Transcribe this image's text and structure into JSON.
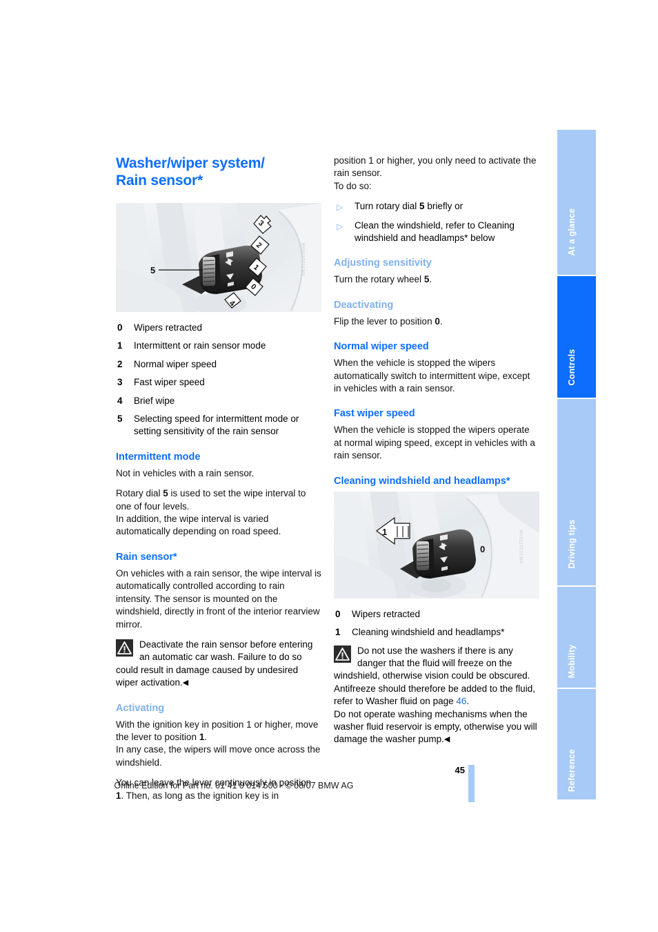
{
  "document": {
    "title": "Washer/wiper system/ Rain sensor*",
    "title_line1": "Washer/wiper system/",
    "title_line2": "Rain sensor*",
    "page_number": "45",
    "footer": "Online Edition for Part no. 01 41 0 014 500 - © 08/07 BMW AG"
  },
  "side_tabs": [
    {
      "label": "At a glance",
      "active": false
    },
    {
      "label": "Controls",
      "active": true
    },
    {
      "label": "Driving tips",
      "active": false
    },
    {
      "label": "Mobility",
      "active": false
    },
    {
      "label": "Reference",
      "active": false
    }
  ],
  "figures": {
    "lever_positions": {
      "caption_watermark": "MVD11TC1CMA",
      "callouts": [
        "0",
        "1",
        "2",
        "3",
        "4",
        "5"
      ]
    },
    "cleaning": {
      "caption_watermark": "MVD11TC1CMA",
      "callouts": [
        "0",
        "1"
      ]
    }
  },
  "left_column": {
    "legend": [
      {
        "num": "0",
        "text": "Wipers retracted"
      },
      {
        "num": "1",
        "text": "Intermittent or rain sensor mode"
      },
      {
        "num": "2",
        "text": "Normal wiper speed"
      },
      {
        "num": "3",
        "text": "Fast wiper speed"
      },
      {
        "num": "4",
        "text": "Brief wipe"
      },
      {
        "num": "5",
        "text": "Selecting speed for intermittent mode or setting sensitivity of the rain sensor"
      }
    ],
    "intermittent": {
      "heading": "Intermittent mode",
      "p1": "Not in vehicles with a rain sensor.",
      "p2_a": "Rotary dial ",
      "p2_b": "5",
      "p2_c": " is used to set the wipe interval to one of four levels.",
      "p3": "In addition, the wipe interval is varied automatically depending on road speed."
    },
    "rain_sensor": {
      "heading": "Rain sensor*",
      "p1": "On vehicles with a rain sensor, the wipe interval is automatically controlled according to rain intensity. The sensor is mounted on the windshield, directly in front of the interior rearview mirror.",
      "warning": "Deactivate the rain sensor before entering an automatic car wash. Failure to do so could result in damage caused by undesired wiper activation."
    },
    "activating": {
      "heading": "Activating",
      "p1_a": "With the ignition key in position 1 or higher, move the lever to position ",
      "p1_b": "1",
      "p1_c": ".",
      "p2": "In any case, the wipers will move once across the windshield.",
      "p3_a": "You can leave the lever continuously in position ",
      "p3_b": "1",
      "p3_c": ". Then, as long as the ignition key is in"
    }
  },
  "right_column": {
    "continuation": {
      "p1": "position 1 or higher, you only need to activate the rain sensor.",
      "p2": "To do so:"
    },
    "bullets": [
      {
        "text_a": "Turn rotary dial ",
        "text_b": "5",
        "text_c": " briefly or"
      },
      {
        "text_a": "Clean the windshield, refer to Cleaning windshield and headlamps* below",
        "text_b": "",
        "text_c": ""
      }
    ],
    "adjusting_sensitivity": {
      "heading": "Adjusting sensitivity",
      "p1_a": "Turn the rotary wheel ",
      "p1_b": "5",
      "p1_c": "."
    },
    "deactivating": {
      "heading": "Deactivating",
      "p1_a": "Flip the lever to position ",
      "p1_b": "0",
      "p1_c": "."
    },
    "normal_wiper_speed": {
      "heading": "Normal wiper speed",
      "p1": "When the vehicle is stopped the wipers automatically switch to intermittent wipe, except in vehicles with a rain sensor."
    },
    "fast_wiper_speed": {
      "heading": "Fast wiper speed",
      "p1": "When the vehicle is stopped the wipers operate at normal wiping speed, except in vehicles with a rain sensor."
    },
    "cleaning": {
      "heading": "Cleaning windshield and headlamps*",
      "legend": [
        {
          "num": "0",
          "text": "Wipers retracted"
        },
        {
          "num": "1",
          "text": "Cleaning windshield and headlamps*"
        }
      ],
      "warning_a": "Do not use the washers if there is any danger that the fluid will freeze on the windshield, otherwise vision could be obscured. Antifreeze should therefore be added to the fluid, refer to Washer fluid on page ",
      "warning_page_ref": "46",
      "warning_b": ".",
      "warning_c": "Do not operate washing mechanisms when the washer fluid reservoir is empty, otherwise you will damage the washer pump."
    }
  },
  "colors": {
    "heading_blue": "#0d6efd",
    "subheading_blue": "#7fb0f2",
    "tab_inactive": "#a7caf7",
    "tab_active": "#0d6efd",
    "page_ref": "#2a6fdb"
  }
}
